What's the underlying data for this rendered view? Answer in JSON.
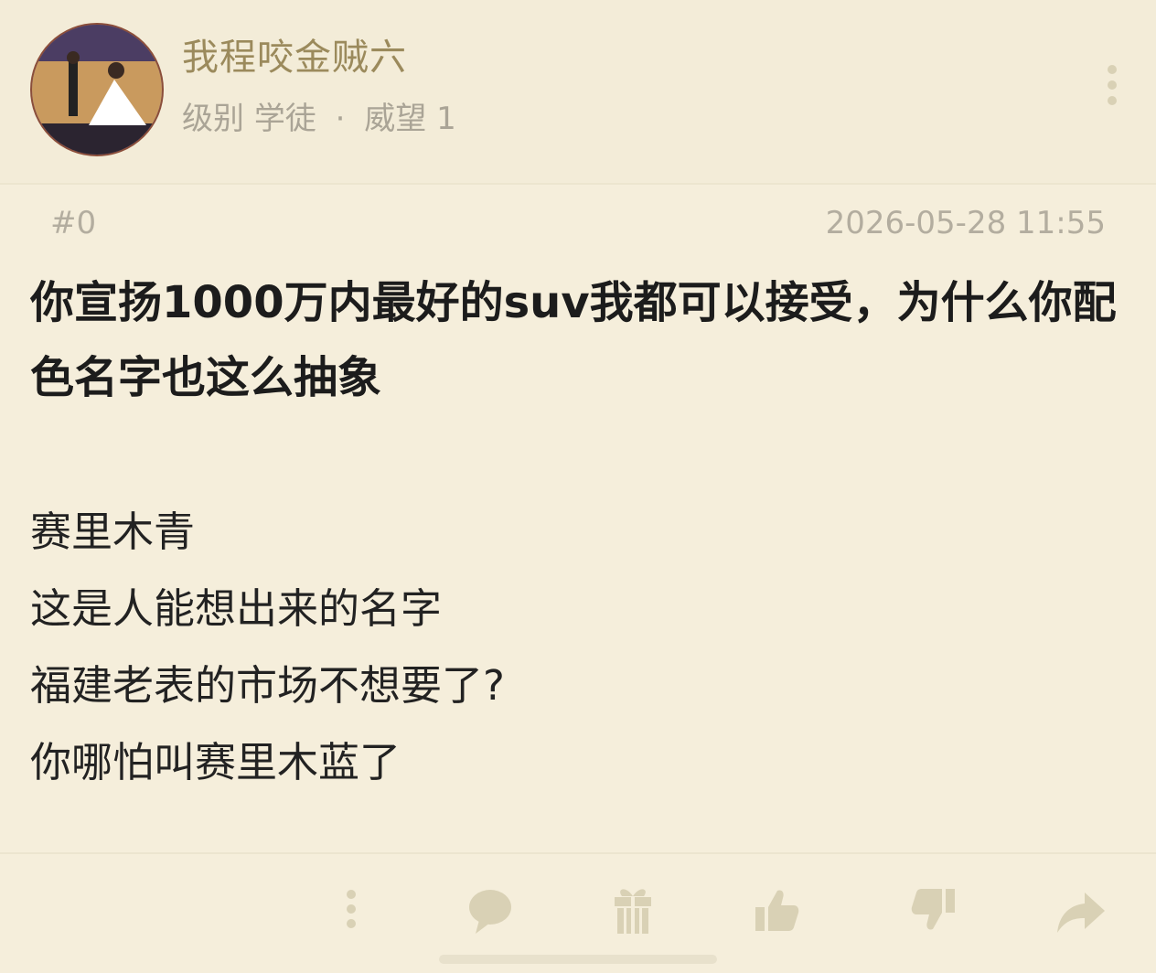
{
  "user": {
    "name": "我程咬金贼六",
    "level_label": "级别",
    "level_value": "学徒",
    "separator": "·",
    "prestige_label": "威望",
    "prestige_value": "1",
    "avatar_icon": "user-avatar"
  },
  "post": {
    "floor": "#0",
    "timestamp": "2026-05-28 11:55",
    "title": "你宣扬1000万内最好的suv我都可以接受，为什么你配色名字也这么抽象",
    "lines": [
      "赛里木青",
      "这是人能想出来的名字",
      "福建老表的市场不想要了?",
      "你哪怕叫赛里木蓝了"
    ]
  },
  "actions": [
    {
      "icon": "more-vertical-icon"
    },
    {
      "icon": "comment-icon"
    },
    {
      "icon": "gift-icon"
    },
    {
      "icon": "thumbs-up-icon"
    },
    {
      "icon": "thumbs-down-icon"
    },
    {
      "icon": "share-icon"
    }
  ],
  "colors": {
    "background": "#f5eedb",
    "username": "#9b8a5c",
    "meta": "#aaa496",
    "icon": "#d9d1b5",
    "text": "#1c1c1c"
  }
}
